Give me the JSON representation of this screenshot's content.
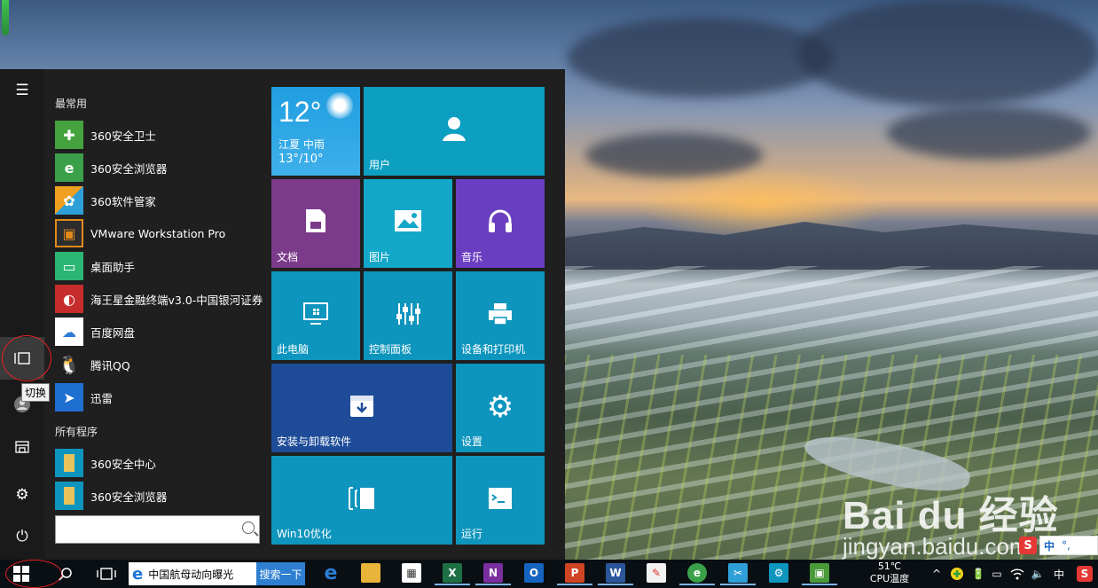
{
  "start_menu": {
    "most_used_title": "最常用",
    "all_programs_title": "所有程序",
    "most_used": [
      {
        "label": "360安全卫士",
        "icon": "360-guard-icon",
        "color": "#45a33f"
      },
      {
        "label": "360安全浏览器",
        "icon": "360-browser-icon",
        "color": "#3aa14a"
      },
      {
        "label": "360软件管家",
        "icon": "360-software-manager-icon",
        "color": "#2f9fd8"
      },
      {
        "label": "VMware Workstation Pro",
        "icon": "vmware-icon",
        "color": "#e28a1b"
      },
      {
        "label": "桌面助手",
        "icon": "desktop-assistant-icon",
        "color": "#2bb673"
      },
      {
        "label": "海王星金融终端v3.0-中国银河证券",
        "icon": "neptune-finance-icon",
        "color": "#c62c2c"
      },
      {
        "label": "百度网盘",
        "icon": "baidu-netdisk-icon",
        "color": "#2f7cd3"
      },
      {
        "label": "腾讯QQ",
        "icon": "qq-icon",
        "color": "#2b2b2b"
      },
      {
        "label": "迅雷",
        "icon": "xunlei-icon",
        "color": "#1f6fd1"
      }
    ],
    "all_programs": [
      {
        "label": "360安全中心",
        "icon": "folder-icon",
        "color": "#e6c35c"
      },
      {
        "label": "360安全浏览器",
        "icon": "folder-icon",
        "color": "#e6c35c"
      }
    ],
    "tooltip": "切换",
    "tiles": {
      "weather": {
        "temp": "12°",
        "city": "江夏  中雨",
        "range": "13°/10°"
      },
      "user": "用户",
      "documents": "文档",
      "pictures": "图片",
      "music": "音乐",
      "this_pc": "此电脑",
      "control_panel": "控制面板",
      "devices_printers": "设备和打印机",
      "install_uninstall": "安装与卸载软件",
      "settings": "设置",
      "win10_optimize": "Win10优化",
      "run": "运行"
    }
  },
  "taskbar": {
    "ie_text": "中国航母动向曝光",
    "search_button": "搜索一下",
    "cpu_temp_value": "51℃",
    "cpu_temp_label": "CPU温度",
    "ime_lang": "中",
    "apps": [
      "edge-icon",
      "file-explorer-icon",
      "store-icon",
      "excel-icon",
      "onenote-icon",
      "outlook-icon",
      "powerpoint-icon",
      "word-icon",
      "paint-icon",
      "360-browser-icon",
      "sniping-icon",
      "settings-icon",
      "photo-icon"
    ]
  },
  "ime_toolbar": {
    "lang": "中",
    "punct": "°,"
  },
  "watermark": {
    "logo": "Bai du 经验",
    "url": "jingyan.baidu.com"
  },
  "colors": {
    "tile_teal": "#0c9fc1",
    "tile_purple": "#7c3b8a",
    "tile_violet": "#6a3ec0",
    "tile_blue": "#1e4c99",
    "tile_cyan": "#0e95bd"
  }
}
